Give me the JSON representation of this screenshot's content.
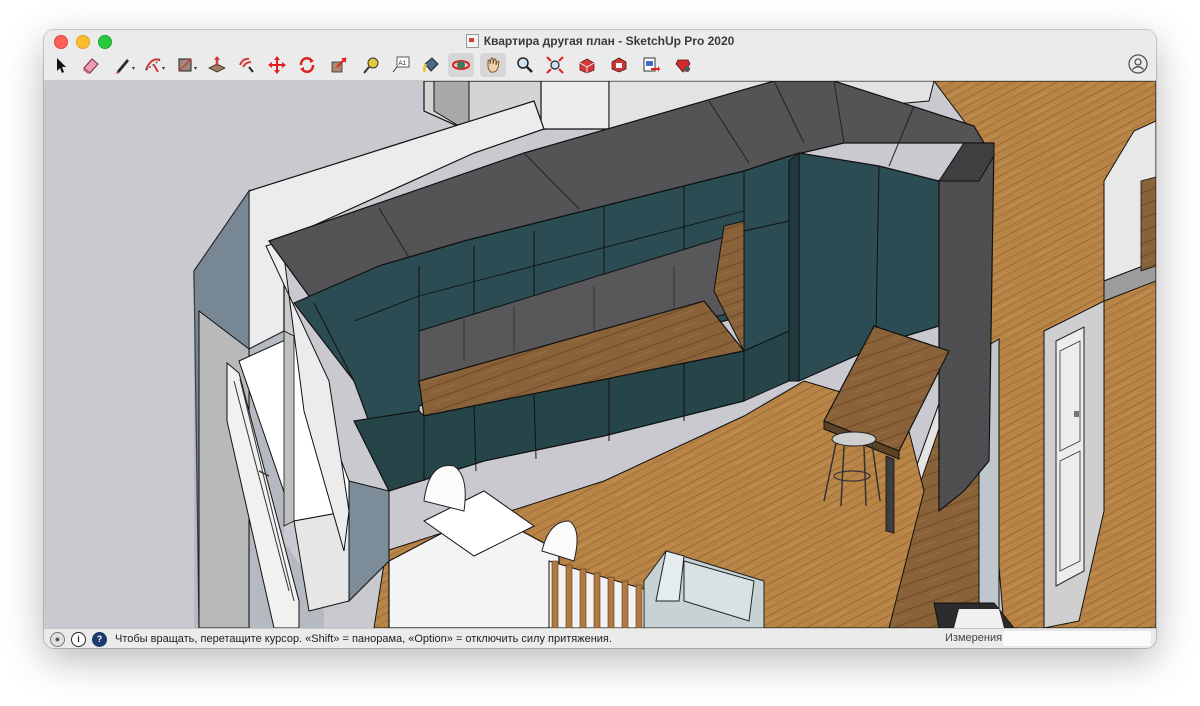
{
  "window": {
    "title": "Квартира другая план - SketchUp Pro 2020"
  },
  "toolbar": {
    "tools": [
      {
        "id": "select",
        "icon": "select-arrow-icon"
      },
      {
        "id": "eraser",
        "icon": "eraser-icon"
      },
      {
        "id": "line",
        "icon": "pencil-line-icon",
        "menu": true
      },
      {
        "id": "arc",
        "icon": "arc-icon",
        "menu": true
      },
      {
        "id": "shapes",
        "icon": "rectangle-shape-icon",
        "menu": true
      },
      {
        "id": "push-pull",
        "icon": "push-pull-icon"
      },
      {
        "id": "offset",
        "icon": "offset-icon"
      },
      {
        "id": "move",
        "icon": "move-icon"
      },
      {
        "id": "rotate",
        "icon": "rotate-icon"
      },
      {
        "id": "scale",
        "icon": "scale-icon"
      },
      {
        "id": "tape-measure",
        "icon": "tape-measure-icon"
      },
      {
        "id": "text",
        "icon": "text-label-icon",
        "label": "A1"
      },
      {
        "id": "paint-bucket",
        "icon": "paint-bucket-icon"
      },
      {
        "id": "orbit",
        "icon": "orbit-icon",
        "active": true
      },
      {
        "id": "pan",
        "icon": "pan-hand-icon",
        "active": true
      },
      {
        "id": "zoom",
        "icon": "zoom-icon"
      },
      {
        "id": "zoom-extents",
        "icon": "zoom-extents-icon"
      },
      {
        "id": "3d-warehouse",
        "icon": "warehouse-icon"
      },
      {
        "id": "extension-warehouse",
        "icon": "extension-warehouse-icon"
      },
      {
        "id": "send-to-layout",
        "icon": "send-to-layout-icon"
      },
      {
        "id": "extension-manager",
        "icon": "extension-manager-icon"
      }
    ],
    "user_icon": "user-account-icon"
  },
  "status": {
    "hint": "Чтобы вращать, перетащите курсор. «Shift» = панорама, «Option» = отключить силу притяжения.",
    "measurements_label": "Измерения",
    "measurements_value": ""
  },
  "colors": {
    "cabinet_teal": "#2a4c52",
    "countertop_top": "#545457",
    "floor_wood": "#b98547",
    "wall_white": "#ececec",
    "wall_blue_gray": "#6b7e8c",
    "sky_background": "#c9c9cf"
  }
}
